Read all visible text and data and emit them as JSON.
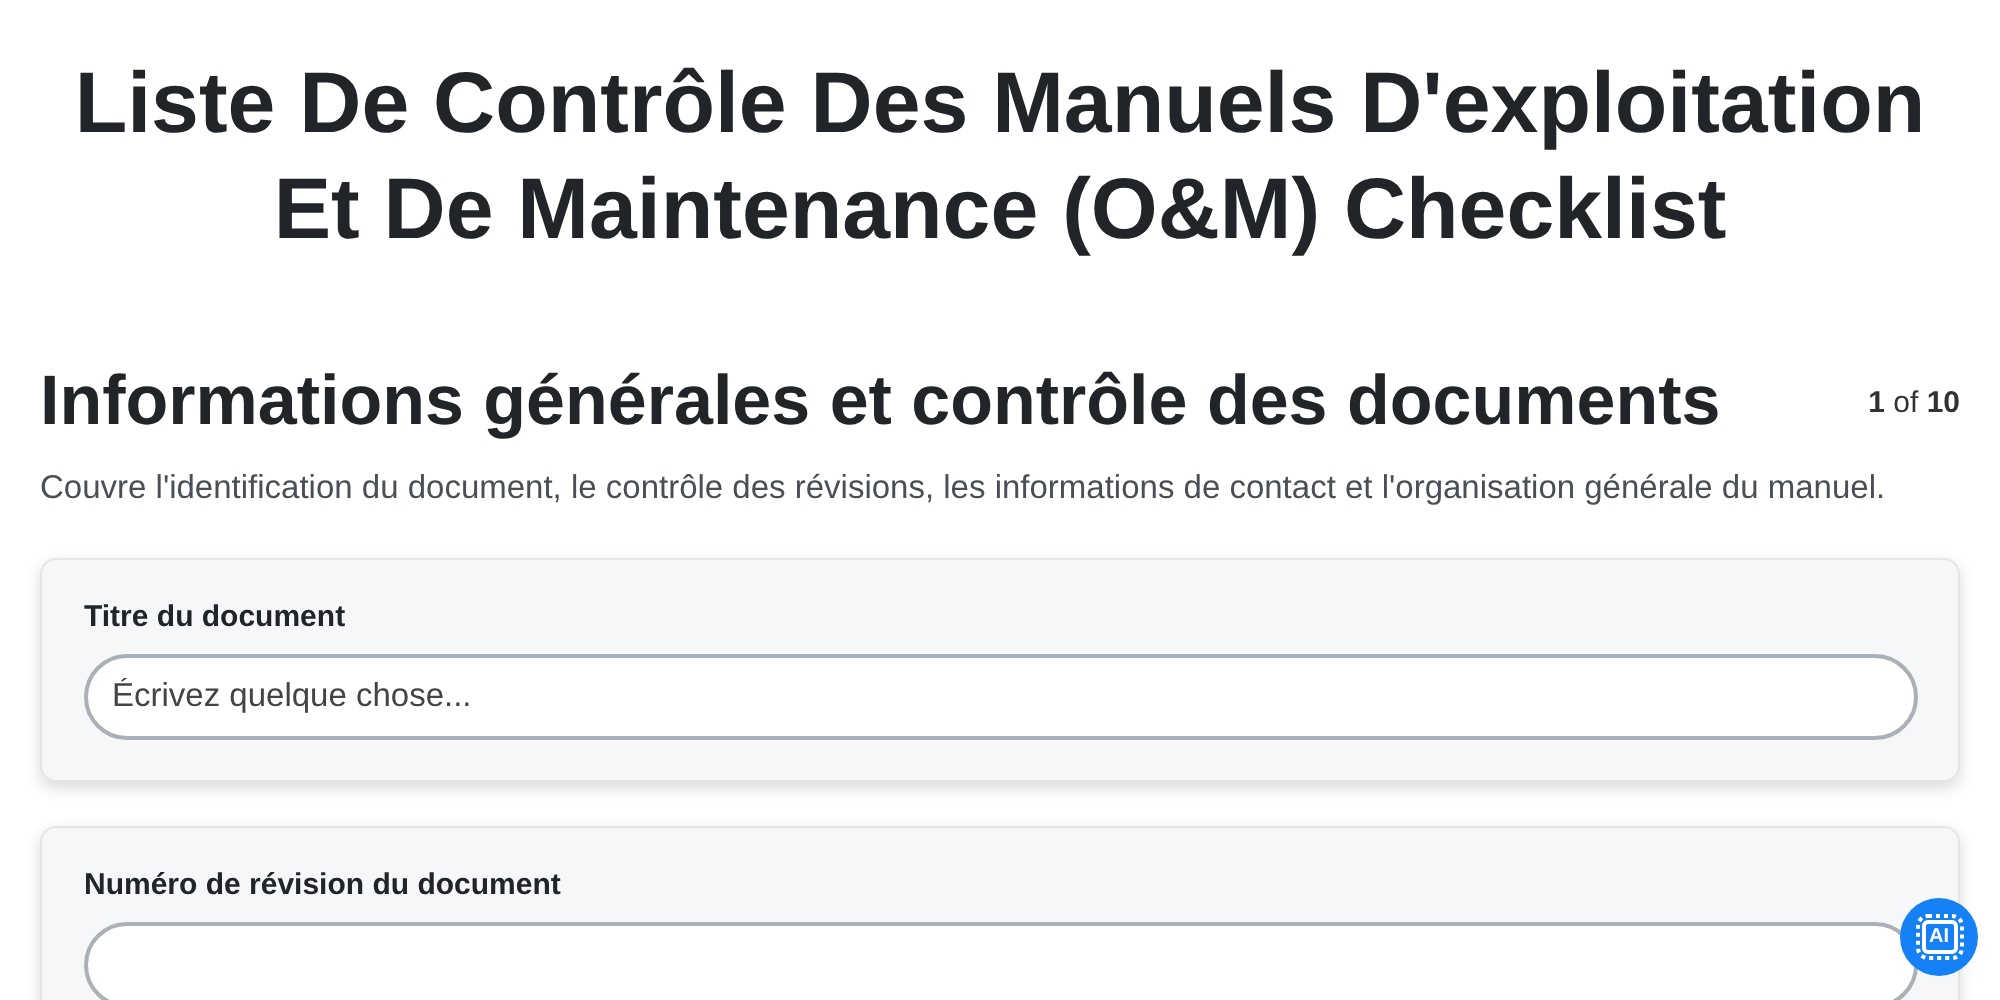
{
  "title": "Liste De Contrôle Des Manuels D'exploitation Et De Maintenance (O&M) Checklist",
  "section": {
    "heading": "Informations générales et contrôle des documents",
    "page_counter": "**1** of **10**",
    "description": "Couvre l'identification du document, le contrôle des révisions, les informations de contact et l'organisation générale du manuel."
  },
  "fields": [
    {
      "label": "Titre du document",
      "placeholder": "Écrivez quelque chose..."
    },
    {
      "label": "Numéro de révision du document"
    }
  ],
  "ai_button": {
    "label": "AI"
  }
}
